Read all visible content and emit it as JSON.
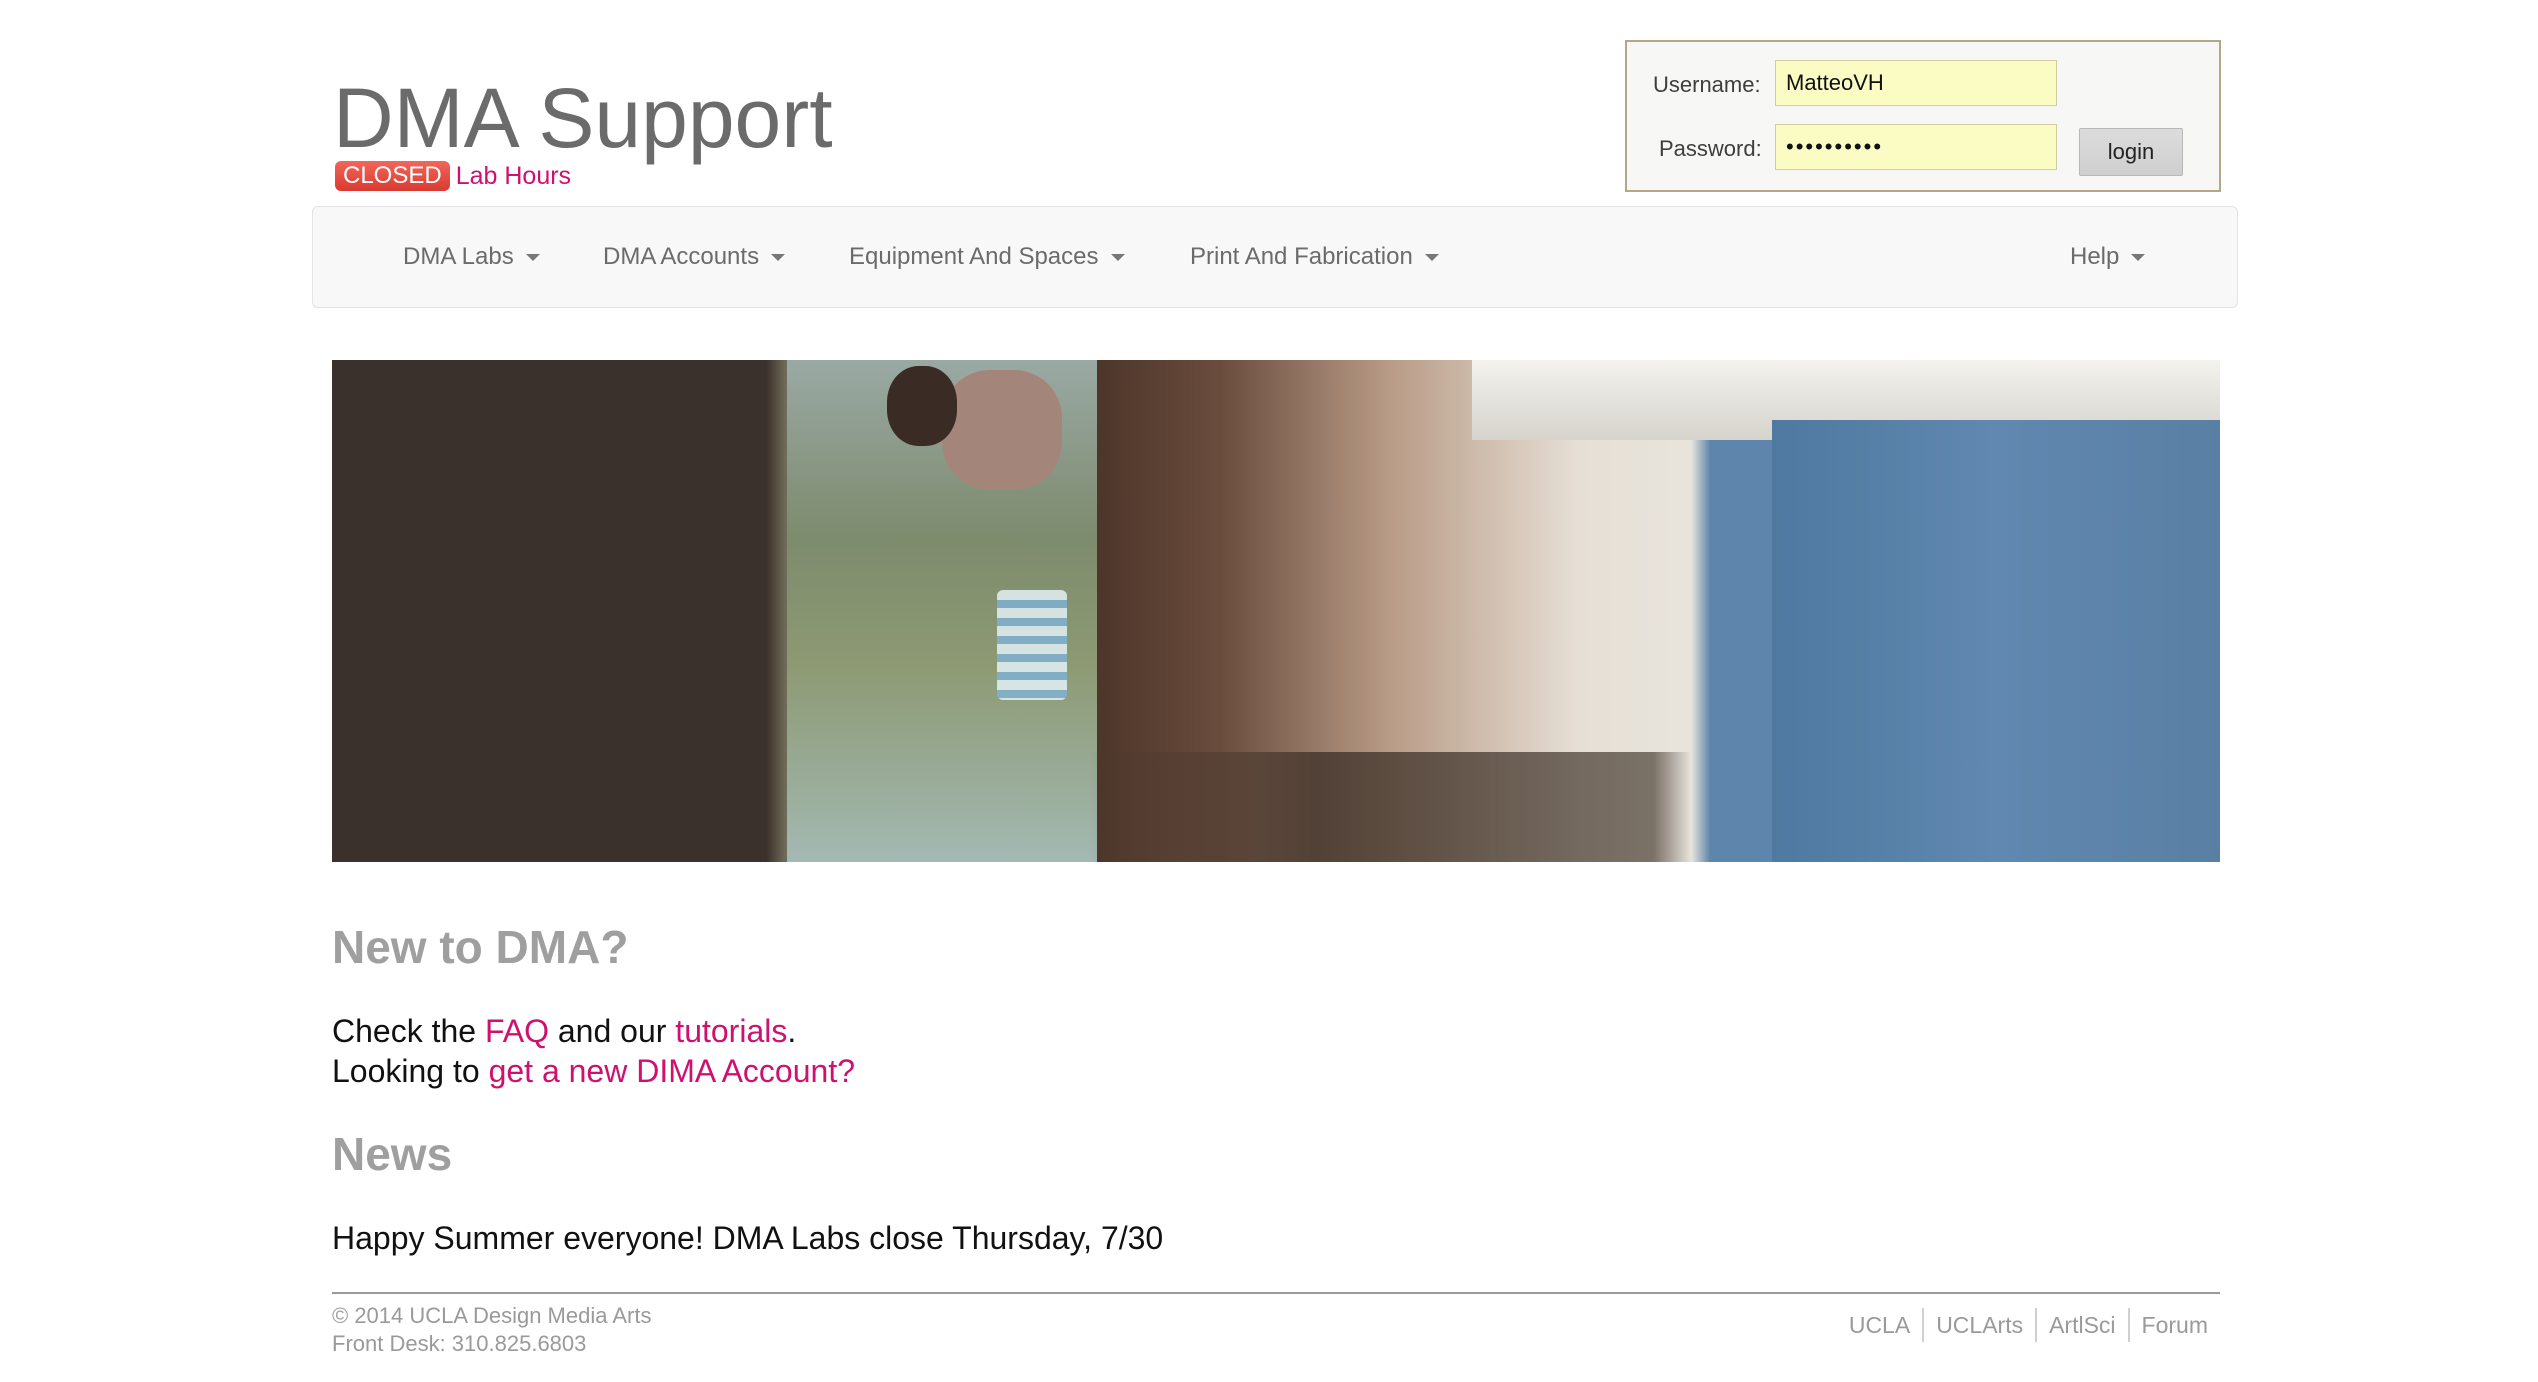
{
  "header": {
    "title": "DMA Support",
    "status_badge": "CLOSED",
    "status_link": "Lab Hours",
    "status_color": "#e74c3c"
  },
  "login": {
    "username_label": "Username:",
    "username_value": "MatteoVH",
    "password_label": "Password:",
    "password_value": "••••••••••",
    "login_button": "login"
  },
  "nav": {
    "items": [
      {
        "label": "DMA Labs"
      },
      {
        "label": "DMA Accounts"
      },
      {
        "label": "Equipment And Spaces"
      },
      {
        "label": "Print And Fabrication"
      }
    ],
    "help": "Help"
  },
  "main": {
    "new_heading": "New to DMA?",
    "line1_prefix": "Check the ",
    "line1_faq": "FAQ",
    "line1_middle": " and our ",
    "line1_tutorials": "tutorials",
    "line1_suffix": ".",
    "line2_prefix": "Looking to ",
    "line2_link": "get a new DIMA Account?",
    "news_heading": "News",
    "news_item": "Happy Summer everyone! DMA Labs close Thursday, 7/30"
  },
  "footer": {
    "copyright": "© 2014 UCLA Design Media Arts",
    "front_desk": "Front Desk: 310.825.6803",
    "links": [
      "UCLA",
      "UCLArts",
      "ArtlSci",
      "Forum"
    ]
  },
  "colors": {
    "accent": "#d0106f",
    "heading_gray": "#9f9f9f",
    "login_field_bg": "#fbfbc4"
  }
}
